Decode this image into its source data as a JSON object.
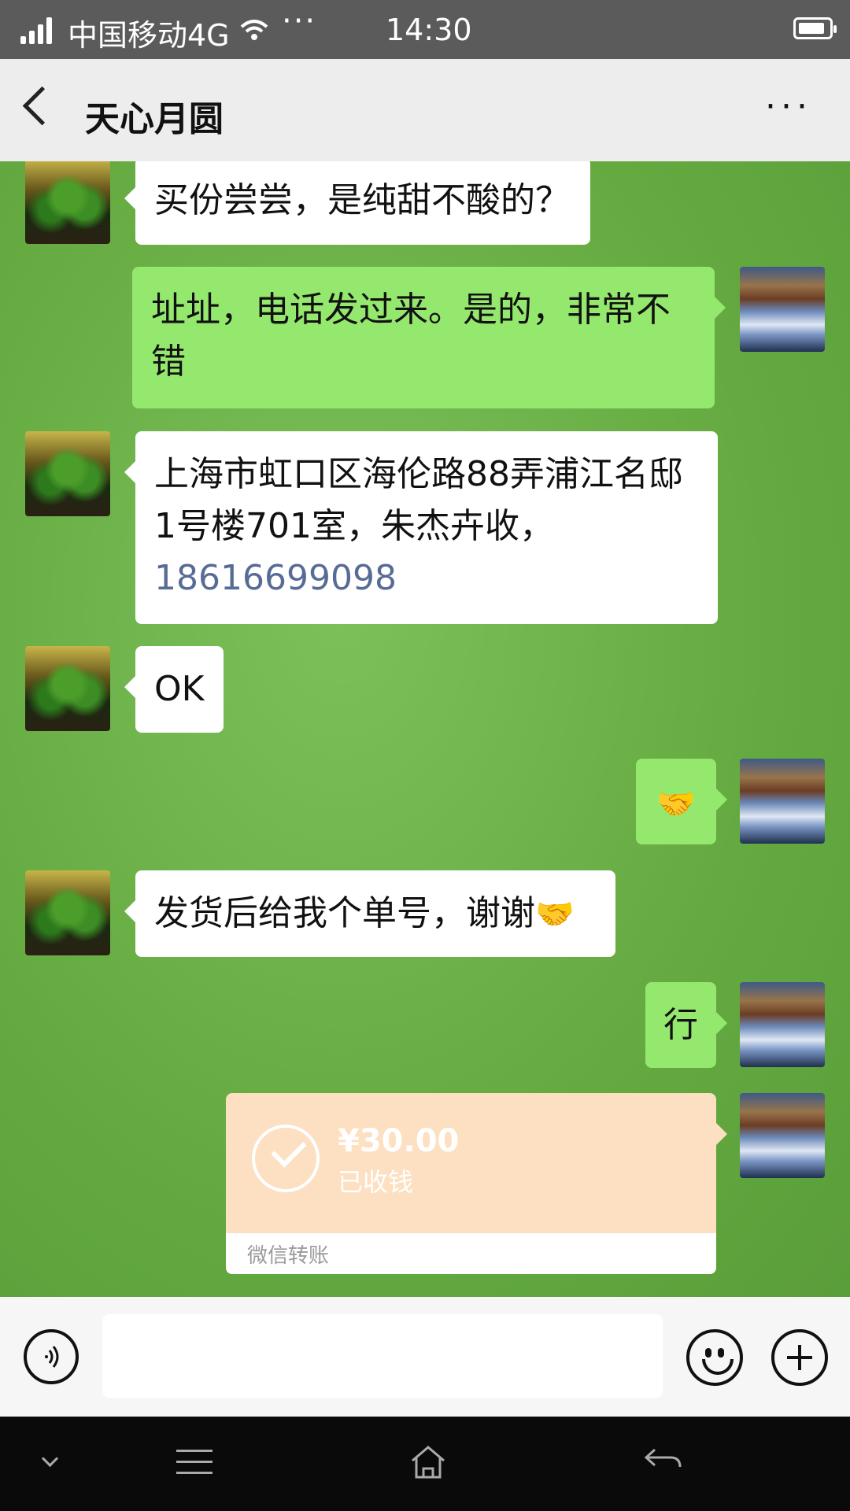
{
  "status_bar": {
    "carrier": "中国移动4G",
    "more_dots": "···",
    "time": "14:30"
  },
  "header": {
    "title": "天心月圆",
    "more_label": "···"
  },
  "messages": [
    {
      "side": "in",
      "text": "买份尝尝，是纯甜不酸的？"
    },
    {
      "side": "out",
      "text": "址址，电话发过来。是的，非常不错"
    },
    {
      "side": "in",
      "text": "上海市虹口区海伦路88弄浦江名邸1号楼701室，朱杰卉收，",
      "phone": "18616699098"
    },
    {
      "side": "in",
      "text": "OK"
    },
    {
      "side": "out",
      "emoji": "🤝"
    },
    {
      "side": "in",
      "text": "发货后给我个单号，谢谢",
      "emoji": "🤝"
    },
    {
      "side": "out",
      "text": "行"
    }
  ],
  "transfer": {
    "amount": "¥30.00",
    "status": "已收钱",
    "source": "微信转账",
    "accent_color": "#fce0c1"
  },
  "input_bar": {
    "icons": [
      "voice-icon",
      "emoji-icon",
      "plus-icon"
    ]
  },
  "system_nav": {
    "icons": [
      "chevron-down-icon",
      "menu-icon",
      "home-icon",
      "back-icon"
    ]
  },
  "colors": {
    "incoming_bubble": "#ffffff",
    "outgoing_bubble": "#95e86e",
    "phone_link": "#576b95",
    "chat_background": "#6aad45"
  }
}
